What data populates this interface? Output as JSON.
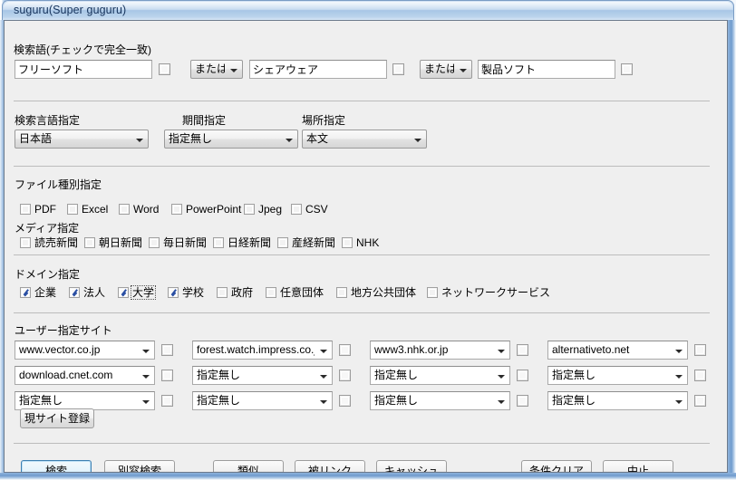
{
  "window": {
    "title": "suguru(Super guguru)"
  },
  "search_terms": {
    "label": "検索語(チェックで完全一致)",
    "fields": [
      {
        "value": "フリーソフト",
        "exact_checked": false
      },
      {
        "value": "シェアウェア",
        "exact_checked": false
      },
      {
        "value": "製品ソフト",
        "exact_checked": false
      }
    ],
    "operators": [
      {
        "value": "または"
      },
      {
        "value": "または"
      }
    ]
  },
  "options_row": {
    "language": {
      "label": "検索言語指定",
      "value": "日本語"
    },
    "period": {
      "label": "期間指定",
      "value": "指定無し"
    },
    "place": {
      "label": "場所指定",
      "value": "本文"
    }
  },
  "filetype": {
    "label": "ファイル種別指定",
    "items": [
      {
        "label": "PDF",
        "checked": false
      },
      {
        "label": "Excel",
        "checked": false
      },
      {
        "label": "Word",
        "checked": false
      },
      {
        "label": "PowerPoint",
        "checked": false
      },
      {
        "label": "Jpeg",
        "checked": false
      },
      {
        "label": "CSV",
        "checked": false
      }
    ]
  },
  "media": {
    "label": "メディア指定",
    "items": [
      {
        "label": "読売新聞",
        "checked": false
      },
      {
        "label": "朝日新聞",
        "checked": false
      },
      {
        "label": "毎日新聞",
        "checked": false
      },
      {
        "label": "日経新聞",
        "checked": false
      },
      {
        "label": "産経新聞",
        "checked": false
      },
      {
        "label": "NHK",
        "checked": false
      }
    ]
  },
  "domain": {
    "label": "ドメイン指定",
    "items": [
      {
        "label": "企業",
        "checked": true,
        "focused": false
      },
      {
        "label": "法人",
        "checked": true,
        "focused": false
      },
      {
        "label": "大学",
        "checked": true,
        "focused": true
      },
      {
        "label": "学校",
        "checked": true,
        "focused": false
      },
      {
        "label": "政府",
        "checked": false,
        "focused": false
      },
      {
        "label": "任意団体",
        "checked": false,
        "focused": false
      },
      {
        "label": "地方公共団体",
        "checked": false,
        "focused": false
      },
      {
        "label": "ネットワークサービス",
        "checked": false,
        "focused": false
      }
    ]
  },
  "user_sites": {
    "label": "ユーザー指定サイト",
    "rows": [
      [
        {
          "value": "www.vector.co.jp",
          "checked": false
        },
        {
          "value": "forest.watch.impress.co.jp",
          "checked": false
        },
        {
          "value": "www3.nhk.or.jp",
          "checked": false
        },
        {
          "value": "alternativeto.net",
          "checked": false
        }
      ],
      [
        {
          "value": "download.cnet.com",
          "checked": false
        },
        {
          "value": "指定無し",
          "checked": false
        },
        {
          "value": "指定無し",
          "checked": false
        },
        {
          "value": "指定無し",
          "checked": false
        }
      ],
      [
        {
          "value": "指定無し",
          "checked": false
        },
        {
          "value": "指定無し",
          "checked": false
        },
        {
          "value": "指定無し",
          "checked": false
        },
        {
          "value": "指定無し",
          "checked": false
        }
      ]
    ],
    "register_button": "現サイト登録"
  },
  "actions": {
    "search": "検索",
    "search_new_window": "別窓検索",
    "similar": "類似",
    "backlink": "被リンク",
    "cache": "キャッシュ",
    "clear": "条件クリア",
    "stop": "中止"
  },
  "colors": {
    "accent": "#3c7fb1",
    "titlebar": "#bcd4ec",
    "client_bg": "#efefef",
    "check_mark": "#2a4fa3"
  }
}
